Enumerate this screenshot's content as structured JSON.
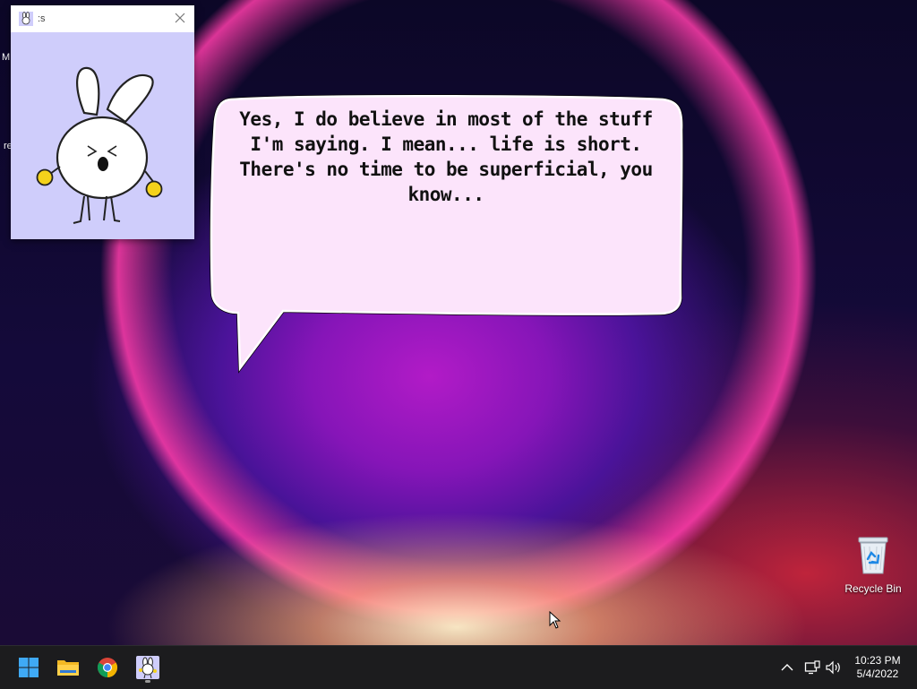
{
  "desktop": {
    "left_edge_labels": [
      "M",
      "re"
    ],
    "recycle_bin": {
      "label": "Recycle Bin",
      "icon": "recycle-bin-icon"
    }
  },
  "pet_window": {
    "title": ":s",
    "app_icon": "bunny-app-icon",
    "background_color": "#cfcdfb"
  },
  "speech_bubble": {
    "text": "Yes, I do believe in most of the stuff I'm saying. I mean... life is short. There's no time to be superficial, you know...",
    "fill_color": "#fce4fb"
  },
  "taskbar": {
    "apps": [
      {
        "name": "Start",
        "icon": "windows-start-icon"
      },
      {
        "name": "File Explorer",
        "icon": "folder-icon"
      },
      {
        "name": "Google Chrome",
        "icon": "chrome-icon"
      },
      {
        "name": "Bunny pet",
        "icon": "bunny-app-icon",
        "active": true
      }
    ],
    "tray": {
      "icons": [
        "chevron-up-icon",
        "network-icon",
        "volume-icon"
      ],
      "time": "10:23 PM",
      "date": "5/4/2022"
    }
  }
}
